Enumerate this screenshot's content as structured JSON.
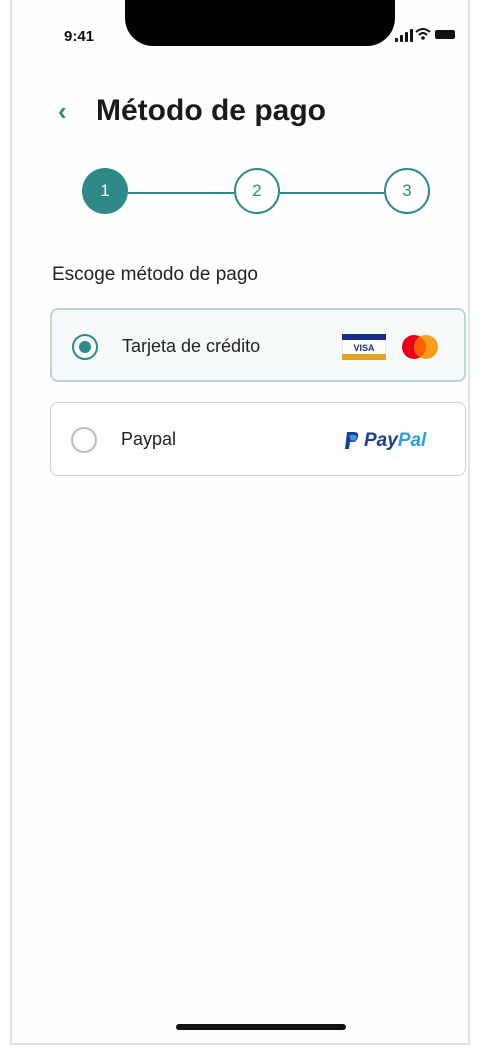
{
  "status_bar": {
    "time": "9:41"
  },
  "header": {
    "back_icon": "chevron-left-icon",
    "title": "Método de pago"
  },
  "stepper": {
    "steps": [
      "1",
      "2",
      "3"
    ],
    "current": 1,
    "accent": "#2f8a87"
  },
  "section": {
    "label": "Escoge método de pago"
  },
  "payment_options": [
    {
      "label": "Tarjeta de crédito",
      "selected": true,
      "logos": [
        "visa-logo",
        "mastercard-logo"
      ],
      "visa_text": "VISA"
    },
    {
      "label": "Paypal",
      "selected": false,
      "logos": [
        "paypal-logo"
      ],
      "brand_pay": "Pay",
      "brand_pal": "Pal"
    }
  ]
}
